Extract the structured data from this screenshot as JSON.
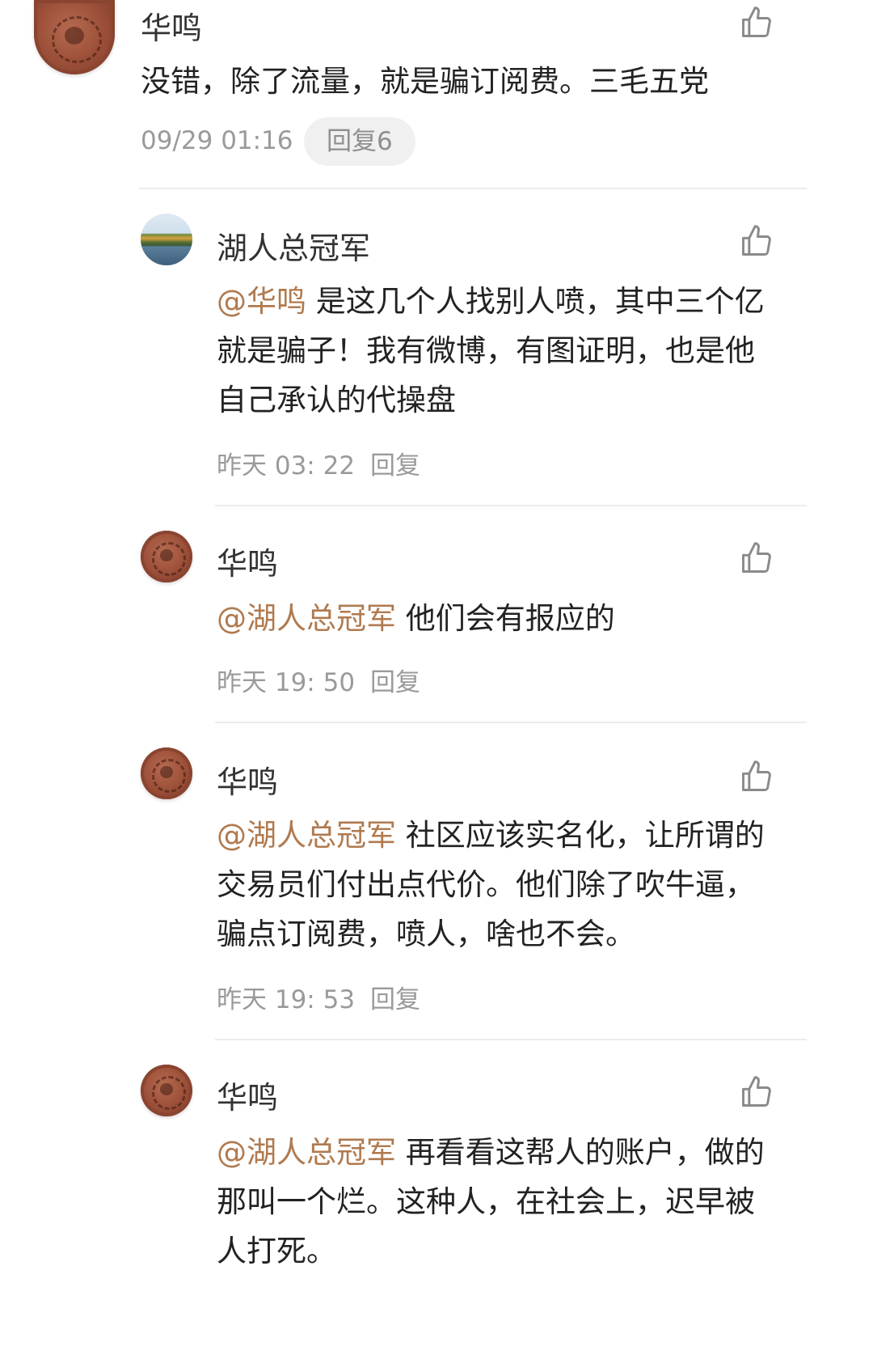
{
  "comments": [
    {
      "name": "华鸣",
      "text": "没错，除了流量，就是骗订阅费。三毛五党",
      "mention": "",
      "time": "09/29 01:16",
      "reply_label": "回复6"
    },
    {
      "name": "湖人总冠军",
      "mention": "@华鸣",
      "text": "是这几个人找别人喷，其中三个亿就是骗子！我有微博，有图证明，也是他自己承认的代操盘",
      "time": "昨天 03: 22",
      "reply_label": "回复"
    },
    {
      "name": "华鸣",
      "mention": "@湖人总冠军",
      "text": "他们会有报应的",
      "time": "昨天 19: 50",
      "reply_label": "回复"
    },
    {
      "name": "华鸣",
      "mention": "@湖人总冠军",
      "text": "社区应该实名化，让所谓的交易员们付出点代价。他们除了吹牛逼，骗点订阅费，喷人，啥也不会。",
      "time": "昨天 19: 53",
      "reply_label": "回复"
    },
    {
      "name": "华鸣",
      "mention": "@湖人总冠军",
      "text": "再看看这帮人的账户，做的那叫一个烂。这种人，在社会上，迟早被人打死。",
      "time": "",
      "reply_label": ""
    }
  ],
  "icons": {
    "like": "thumbs-up-icon",
    "avatar_seal": "seal-avatar",
    "avatar_lake": "lake-avatar"
  },
  "colors": {
    "mention": "#b07a4f",
    "meta": "#9a9a9a",
    "divider": "#ececec"
  }
}
